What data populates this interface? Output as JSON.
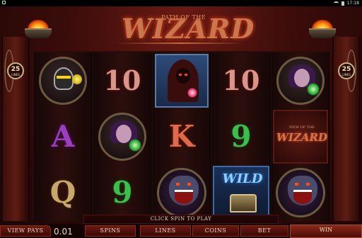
{
  "status_bar": {
    "time": "17:18"
  },
  "title": {
    "small": "PATH OF THE",
    "big": "WIZARD"
  },
  "lines_badge": {
    "number": "25",
    "label": "LINES"
  },
  "reels": [
    [
      "knight",
      "10",
      "A"
    ],
    [
      "10",
      "witch",
      "9"
    ],
    [
      "wizard",
      "K",
      "demon"
    ],
    [
      "10",
      "9",
      "wild"
    ],
    [
      "witch",
      "logo",
      "demon"
    ]
  ],
  "symbol_text": {
    "wild": "WILD",
    "logo_small": "PATH OF THE",
    "logo_big": "WIZARD",
    "q": "Q"
  },
  "banner": {
    "text": "CLICK SPIN TO PLAY"
  },
  "bottom": {
    "view_pays": "VIEW PAYS",
    "coin_value": "0.01",
    "spins": "SPINS",
    "lines": "LINES",
    "coins": "COINS",
    "bet": "BET",
    "win": "WIN"
  },
  "icons": [
    "flame-icon",
    "brazier-icon",
    "wifi-icon",
    "battery-icon"
  ],
  "colors": {
    "accent": "#c9774e",
    "background": "#3a0c0a",
    "button": "#6a1a12"
  }
}
